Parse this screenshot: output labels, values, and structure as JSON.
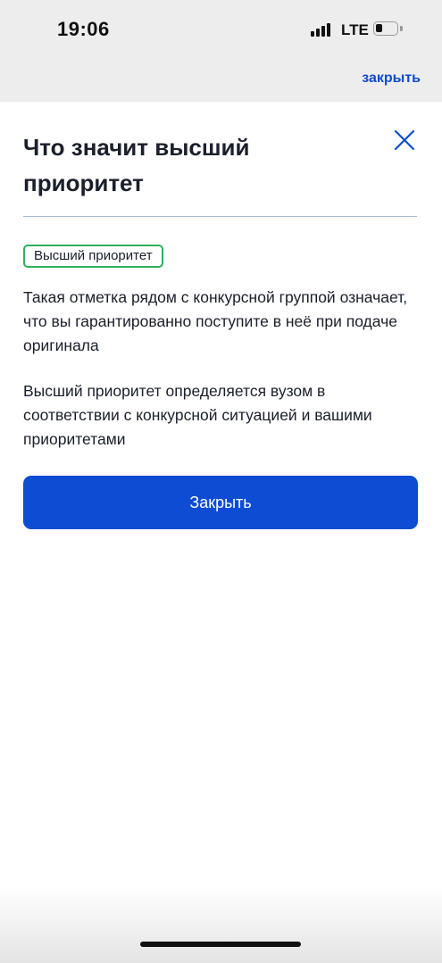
{
  "status_bar": {
    "time": "19:06",
    "network": "LTE",
    "icons": [
      "signal-icon",
      "battery-icon"
    ]
  },
  "header": {
    "close_link": "закрыть"
  },
  "modal": {
    "title": "Что значит высший приоритет",
    "close_icon": "close-icon",
    "badge": "Высший приоритет",
    "paragraph_1": "Такая отметка рядом с конкурсной группой означает, что вы гарантированно поступите в неё при подаче оригинала",
    "paragraph_2": "Высший приоритет определяется вузом в соответствии с конкурсной ситуацией и вашими приоритетами",
    "button_label": "Закрыть"
  },
  "colors": {
    "accent": "#0d4cd3",
    "badge_border": "#2fb15a",
    "text": "#1a1f2b",
    "divider": "#aab8d8"
  }
}
